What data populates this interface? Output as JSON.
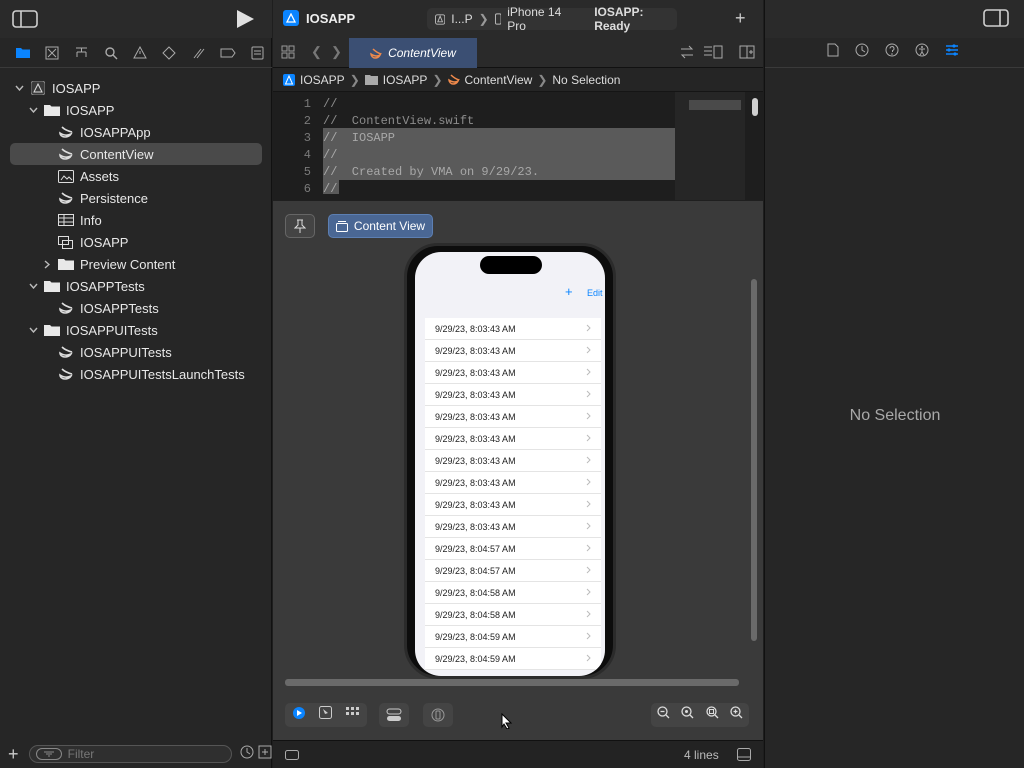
{
  "toolbar": {
    "project": "IOSAPP",
    "scheme": "I...P",
    "device": "iPhone 14 Pro",
    "status": "IOSAPP: Ready"
  },
  "navigator": {
    "tree": [
      {
        "label": "IOSAPP",
        "depth": 0,
        "expanded": true,
        "icon": "project-icon"
      },
      {
        "label": "IOSAPP",
        "depth": 1,
        "expanded": true,
        "icon": "folder-icon"
      },
      {
        "label": "IOSAPPApp",
        "depth": 2,
        "icon": "swift-file-icon"
      },
      {
        "label": "ContentView",
        "depth": 2,
        "icon": "swift-file-icon",
        "selected": true
      },
      {
        "label": "Assets",
        "depth": 2,
        "icon": "asset-catalog-icon"
      },
      {
        "label": "Persistence",
        "depth": 2,
        "icon": "swift-file-icon"
      },
      {
        "label": "Info",
        "depth": 2,
        "icon": "plist-icon"
      },
      {
        "label": "IOSAPP",
        "depth": 2,
        "icon": "datamodel-icon"
      },
      {
        "label": "Preview Content",
        "depth": 2,
        "collapsed": true,
        "icon": "folder-icon"
      },
      {
        "label": "IOSAPPTests",
        "depth": 1,
        "expanded": true,
        "icon": "folder-icon"
      },
      {
        "label": "IOSAPPTests",
        "depth": 2,
        "icon": "swift-file-icon"
      },
      {
        "label": "IOSAPPUITests",
        "depth": 1,
        "expanded": true,
        "icon": "folder-icon"
      },
      {
        "label": "IOSAPPUITests",
        "depth": 2,
        "icon": "swift-file-icon"
      },
      {
        "label": "IOSAPPUITestsLaunchTests",
        "depth": 2,
        "icon": "swift-file-icon"
      }
    ],
    "filter_placeholder": "Filter"
  },
  "editor": {
    "tab_label": "ContentView",
    "breadcrumb": [
      "IOSAPP",
      "IOSAPP",
      "ContentView",
      "No Selection"
    ],
    "code": [
      {
        "n": "1",
        "text": "//"
      },
      {
        "n": "2",
        "text": "//  ContentView.swift"
      },
      {
        "n": "3",
        "text": "//  IOSAPP"
      },
      {
        "n": "4",
        "text": "//"
      },
      {
        "n": "5",
        "text": "//  Created by VMA on 9/29/23."
      },
      {
        "n": "6",
        "text": "//"
      }
    ],
    "preview_label": "Content View",
    "status_lines": "4 lines"
  },
  "device_screen": {
    "add_label": "+",
    "edit_label": "Edit",
    "items": [
      "9/29/23, 8:03:43 AM",
      "9/29/23, 8:03:43 AM",
      "9/29/23, 8:03:43 AM",
      "9/29/23, 8:03:43 AM",
      "9/29/23, 8:03:43 AM",
      "9/29/23, 8:03:43 AM",
      "9/29/23, 8:03:43 AM",
      "9/29/23, 8:03:43 AM",
      "9/29/23, 8:03:43 AM",
      "9/29/23, 8:03:43 AM",
      "9/29/23, 8:04:57 AM",
      "9/29/23, 8:04:57 AM",
      "9/29/23, 8:04:58 AM",
      "9/29/23, 8:04:58 AM",
      "9/29/23, 8:04:59 AM",
      "9/29/23, 8:04:59 AM"
    ]
  },
  "inspector": {
    "empty_label": "No Selection"
  },
  "colors": {
    "accent": "#0a84ff",
    "selection_highlight": "#5a5a5a",
    "tab_active": "#3b4f73"
  }
}
